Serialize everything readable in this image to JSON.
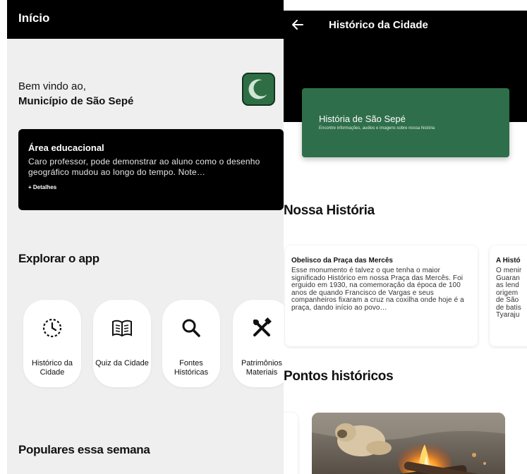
{
  "home": {
    "title": "Início",
    "welcome_line1": "Bem vindo ao,",
    "welcome_line2": "Município de São Sepé",
    "edu_card": {
      "title": "Área educacional",
      "text": "Caro professor, pode demonstrar ao aluno como o desenho geográfico mudou ao longo do tempo. Note…",
      "link": "+ Detalhes"
    },
    "explore_title": "Explorar o app",
    "menu": [
      {
        "icon": "clock-icon",
        "label": "Histórico da Cidade"
      },
      {
        "icon": "book-icon",
        "label": "Quiz da Cidade"
      },
      {
        "icon": "search-icon",
        "label": "Fontes Históricas"
      },
      {
        "icon": "tools-icon",
        "label": "Patrimônios Materiais"
      }
    ],
    "popular_title": "Populares essa semana"
  },
  "history": {
    "title": "Histórico da Cidade",
    "banner_title": "História de São Sepé",
    "banner_subtitle": "Encontre informações, audios e imagens sobre nossa história",
    "section_story": "Nossa História",
    "cards": [
      {
        "title": "Obelisco da Praça das Mercês",
        "text": "Esse monumento é talvez o que tenha o maior significado Histórico em nossa Praça das Mercês. Foi erguido em 1930, na comemoração da época de 100 anos de quando Francisco de Vargas e seus companheiros fixaram a cruz na coxilha onde hoje é a praça, dando início ao povo…"
      },
      {
        "title": "A Histó",
        "text": "O menir\nGuaran\nas lend\norigem\nde São\nde batis\nTyaraju"
      }
    ],
    "section_points": "Pontos históricos"
  },
  "colors": {
    "brand_green": "#2f6e4b",
    "topbar": "#000000",
    "background": "#efefef"
  }
}
